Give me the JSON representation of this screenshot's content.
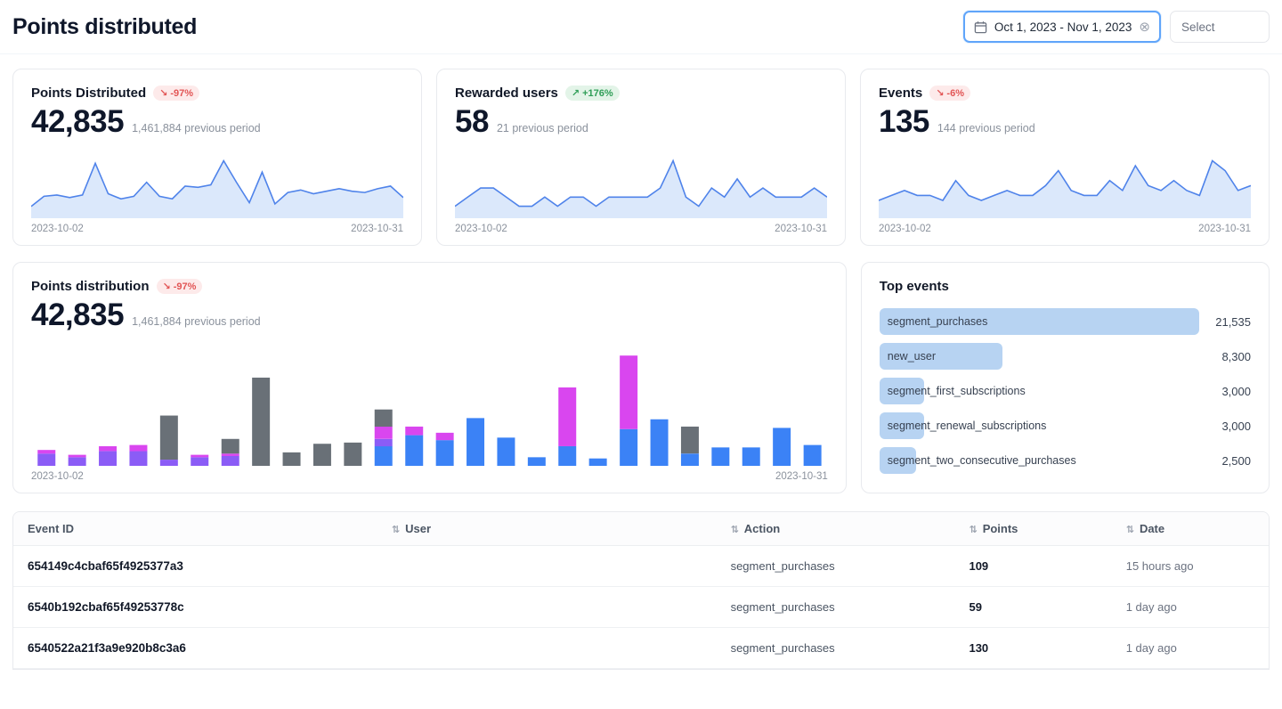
{
  "page": {
    "title": "Points distributed"
  },
  "controls": {
    "date_range": {
      "value": "Oct 1, 2023 - Nov 1, 2023",
      "clear_glyph": "⊗"
    },
    "select": {
      "placeholder": "Select"
    }
  },
  "stat_cards": [
    {
      "title": "Points Distributed",
      "badge": {
        "arrow": "↘",
        "label": "-97%",
        "type": "negative"
      },
      "value": "42,835",
      "subtitle": "1,461,884 previous period",
      "date_start": "2023-10-02",
      "date_end": "2023-10-31"
    },
    {
      "title": "Rewarded users",
      "badge": {
        "arrow": "↗",
        "label": "+176%",
        "type": "positive"
      },
      "value": "58",
      "subtitle": "21 previous period",
      "date_start": "2023-10-02",
      "date_end": "2023-10-31"
    },
    {
      "title": "Events",
      "badge": {
        "arrow": "↘",
        "label": "-6%",
        "type": "negative"
      },
      "value": "135",
      "subtitle": "144 previous period",
      "date_start": "2023-10-02",
      "date_end": "2023-10-31"
    }
  ],
  "distribution_card": {
    "title": "Points distribution",
    "badge": {
      "arrow": "↘",
      "label": "-97%",
      "type": "negative"
    },
    "value": "42,835",
    "subtitle": "1,461,884 previous period",
    "date_start": "2023-10-02",
    "date_end": "2023-10-31"
  },
  "top_events": {
    "title": "Top events",
    "items": [
      {
        "label": "segment_purchases",
        "value": "21,535",
        "value_num": 21535
      },
      {
        "label": "new_user",
        "value": "8,300",
        "value_num": 8300
      },
      {
        "label": "segment_first_subscriptions",
        "value": "3,000",
        "value_num": 3000
      },
      {
        "label": "segment_renewal_subscriptions",
        "value": "3,000",
        "value_num": 3000
      },
      {
        "label": "segment_two_consecutive_purchases",
        "value": "2,500",
        "value_num": 2500
      }
    ]
  },
  "table": {
    "sort_glyph": "⇅",
    "columns": [
      {
        "label": "Event ID"
      },
      {
        "label": "User"
      },
      {
        "label": "Action"
      },
      {
        "label": "Points"
      },
      {
        "label": "Date"
      }
    ],
    "rows": [
      {
        "event_id": "654149c4cbaf65f4925377a3",
        "user": "",
        "action": "segment_purchases",
        "points": "109",
        "date": "15 hours ago"
      },
      {
        "event_id": "6540b192cbaf65f49253778c",
        "user": "",
        "action": "segment_purchases",
        "points": "59",
        "date": "1 day ago"
      },
      {
        "event_id": "6540522a21f3a9e920b8c3a6",
        "user": "",
        "action": "segment_purchases",
        "points": "130",
        "date": "1 day ago"
      }
    ]
  },
  "chart_data": [
    {
      "name": "points_distributed_sparkline",
      "type": "area",
      "color": "#4f83ea",
      "fill": "#dbe8fb",
      "x_start": "2023-10-02",
      "x_end": "2023-10-31",
      "values": [
        700,
        1500,
        1600,
        1400,
        1600,
        4100,
        1700,
        1300,
        1500,
        2600,
        1500,
        1300,
        2300,
        2200,
        2400,
        4300,
        2600,
        1000,
        3400,
        900,
        1800,
        2000,
        1700,
        1900,
        2100,
        1900,
        1800,
        2100,
        2300,
        1400
      ]
    },
    {
      "name": "rewarded_users_sparkline",
      "type": "area",
      "color": "#4f83ea",
      "fill": "#dbe8fb",
      "x_start": "2023-10-02",
      "x_end": "2023-10-31",
      "values": [
        1,
        2,
        3,
        3,
        2,
        1,
        1,
        2,
        1,
        2,
        2,
        1,
        2,
        2,
        2,
        2,
        3,
        6,
        2,
        1,
        3,
        2,
        4,
        2,
        3,
        2,
        2,
        2,
        3,
        2
      ]
    },
    {
      "name": "events_sparkline",
      "type": "area",
      "color": "#4f83ea",
      "fill": "#dbe8fb",
      "x_start": "2023-10-02",
      "x_end": "2023-10-31",
      "values": [
        3,
        4,
        5,
        4,
        4,
        3,
        7,
        4,
        3,
        4,
        5,
        4,
        4,
        6,
        9,
        5,
        4,
        4,
        7,
        5,
        10,
        6,
        5,
        7,
        5,
        4,
        11,
        9,
        5,
        6
      ]
    },
    {
      "name": "points_distribution_stacked_bars",
      "type": "bar",
      "stacked": true,
      "x_start": "2023-10-02",
      "x_end": "2023-10-31",
      "categories": [
        1,
        2,
        3,
        4,
        5,
        6,
        7,
        8,
        9,
        10,
        11,
        12,
        13,
        14,
        15,
        16,
        17,
        18,
        19,
        20,
        21,
        22,
        23,
        24,
        25,
        26
      ],
      "series": [
        {
          "name": "blue",
          "color": "#3b82f6",
          "values": [
            0,
            0,
            0,
            0,
            0,
            0,
            0,
            0,
            0,
            0,
            0,
            800,
            1250,
            1050,
            1950,
            1150,
            350,
            800,
            300,
            1500,
            1900,
            500,
            750,
            750,
            1550,
            850
          ]
        },
        {
          "name": "violet",
          "color": "#8b5cf6",
          "values": [
            500,
            350,
            600,
            600,
            250,
            350,
            400,
            0,
            0,
            0,
            0,
            300,
            0,
            0,
            0,
            0,
            0,
            0,
            0,
            0,
            0,
            0,
            0,
            0,
            0,
            0
          ]
        },
        {
          "name": "magenta",
          "color": "#d946ef",
          "values": [
            150,
            100,
            200,
            250,
            0,
            100,
            100,
            0,
            0,
            0,
            0,
            500,
            350,
            300,
            0,
            0,
            0,
            2400,
            0,
            3000,
            0,
            0,
            0,
            0,
            0,
            0
          ]
        },
        {
          "name": "gray",
          "color": "#697077",
          "values": [
            0,
            0,
            0,
            0,
            1800,
            0,
            600,
            3600,
            550,
            900,
            950,
            700,
            0,
            0,
            0,
            0,
            0,
            0,
            0,
            0,
            0,
            1100,
            0,
            0,
            0,
            0
          ]
        }
      ]
    },
    {
      "name": "top_events_bars",
      "type": "bar",
      "orientation": "horizontal",
      "categories": [
        "segment_purchases",
        "new_user",
        "segment_first_subscriptions",
        "segment_renewal_subscriptions",
        "segment_two_consecutive_purchases"
      ],
      "values": [
        21535,
        8300,
        3000,
        3000,
        2500
      ]
    }
  ]
}
